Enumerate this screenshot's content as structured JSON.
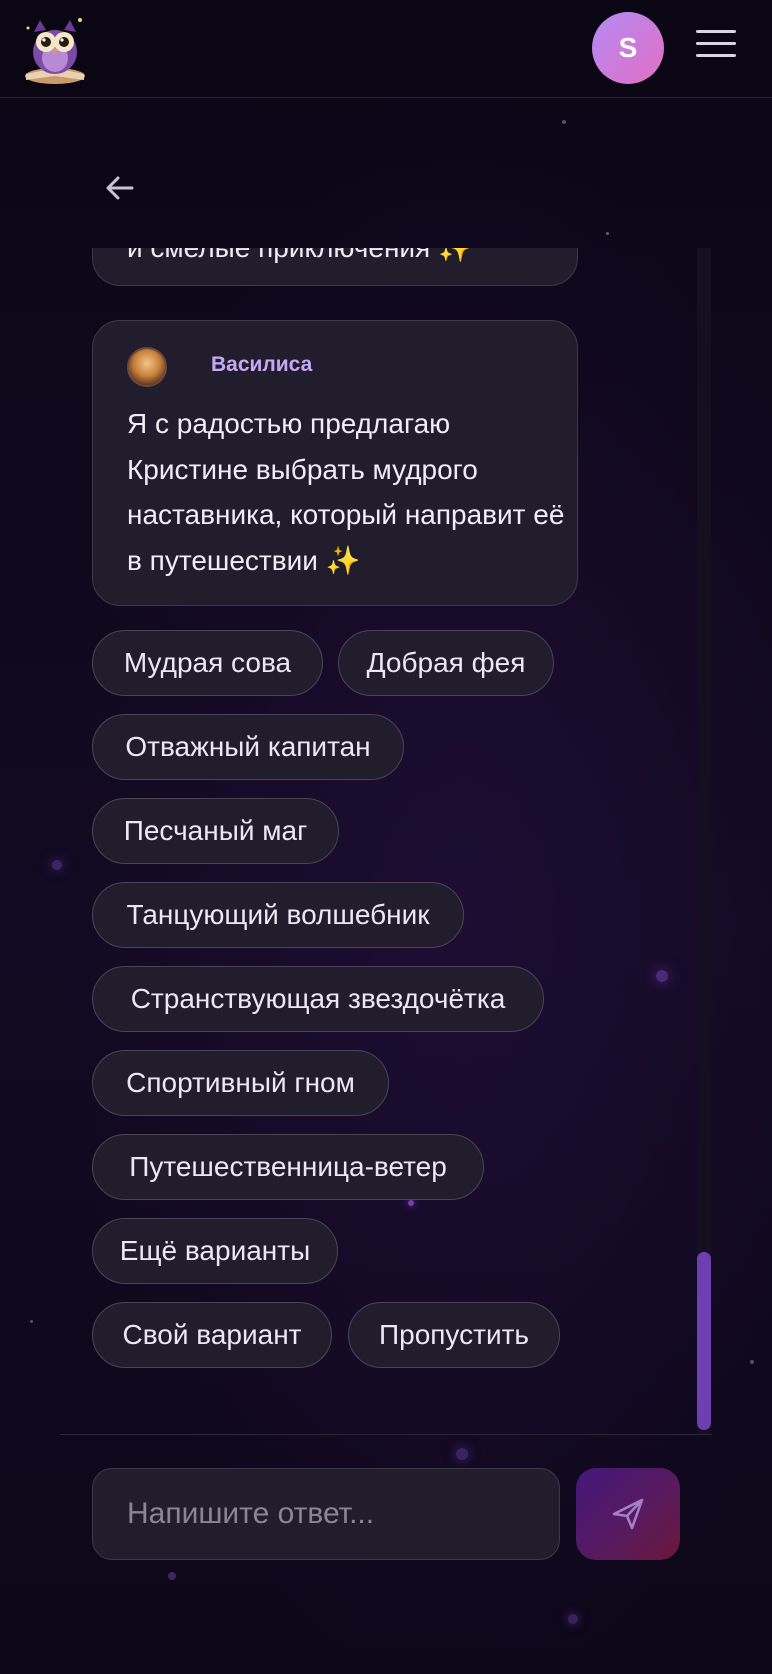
{
  "header": {
    "logo_icon": "owl-logo-icon",
    "user_initial": "S",
    "menu_icon": "hamburger-menu-icon"
  },
  "nav": {
    "back_icon": "arrow-left-icon"
  },
  "chat": {
    "previous_message_tail": "и смелые приключения ✨",
    "message": {
      "sender": "Василиса",
      "text": "Я с радостью предлагаю Кристине выбрать мудрого наставника, который направит её в путешествии ✨"
    },
    "options": [
      "Мудрая сова",
      "Добрая фея",
      "Отважный капитан",
      "Песчаный маг",
      "Танцующий волшебник",
      "Странствующая звездочётка",
      "Спортивный гном",
      "Путешественница-ветер",
      "Ещё варианты",
      "Свой вариант",
      "Пропустить"
    ]
  },
  "composer": {
    "placeholder": "Напишите ответ...",
    "send_icon": "paper-plane-icon"
  },
  "colors": {
    "background": "#0c0717",
    "bubble": "#221d2c",
    "accent_name": "#c7a8f7",
    "avatar_gradient_start": "#b58af4",
    "avatar_gradient_end": "#e26ec4",
    "scrollbar": "#6d3fb2"
  }
}
